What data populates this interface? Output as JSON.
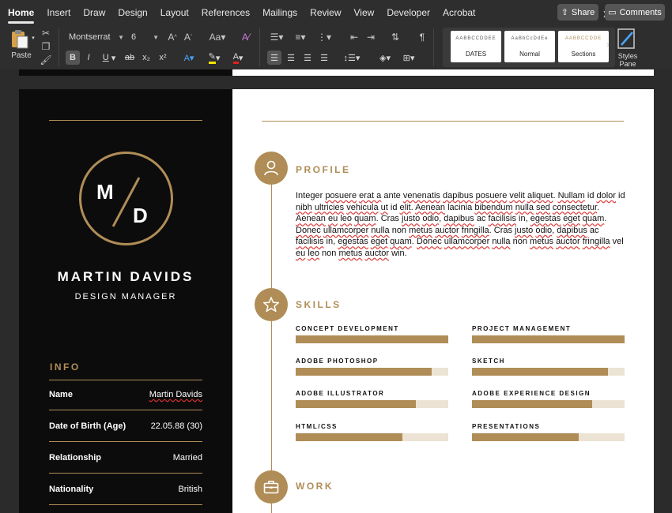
{
  "ribbon": {
    "tabs": [
      "Home",
      "Insert",
      "Draw",
      "Design",
      "Layout",
      "References",
      "Mailings",
      "Review",
      "View",
      "Developer",
      "Acrobat"
    ],
    "active_tab": "Home",
    "share_label": "Share",
    "comments_label": "Comments",
    "paste_label": "Paste",
    "font_name": "Montserrat",
    "font_size": "6",
    "styles": [
      {
        "sample": "AABBCCDDEE",
        "label": "DATES"
      },
      {
        "sample": "AaBbCcDdEe",
        "label": "Normal"
      },
      {
        "sample": "AABBCCDDE",
        "label": "Sections"
      }
    ],
    "styles_pane_label": "Styles Pane",
    "accent_color": "#b08d57"
  },
  "resume": {
    "monogram_first": "M",
    "monogram_second": "D",
    "name": "MARTIN DAVIDS",
    "role": "DESIGN MANAGER",
    "info_heading": "INFO",
    "info": [
      {
        "key": "Name",
        "value": "Martin Davids"
      },
      {
        "key": "Date of Birth (Age)",
        "value": "22.05.88 (30)"
      },
      {
        "key": "Relationship",
        "value": "Married"
      },
      {
        "key": "Nationality",
        "value": "British"
      }
    ],
    "sections": {
      "profile_title": "PROFILE",
      "skills_title": "SKILLS",
      "work_title": "WORK"
    },
    "profile_text": "Integer posuere erat a ante venenatis dapibus posuere velit aliquet. Nullam id dolor id nibh ultricies vehicula ut id elit. Aenean lacinia bibendum nulla sed consectetur. Aenean eu leo quam. Cras justo odio, dapibus ac facilisis in, egestas eget quam. Donec ullamcorper nulla non metus auctor fringilla. Cras justo odio, dapibus ac facilisis in, egestas eget quam. Donec ullamcorper nulla non metus auctor fringilla vel eu leo non metus auctor win.",
    "skills": [
      {
        "label": "CONCEPT DEVELOPMENT",
        "level": 1.0
      },
      {
        "label": "PROJECT MANAGEMENT",
        "level": 1.0
      },
      {
        "label": "ADOBE PHOTOSHOP",
        "level": 0.89
      },
      {
        "label": "SKETCH",
        "level": 0.89
      },
      {
        "label": "ADOBE ILLUSTRATOR",
        "level": 0.79
      },
      {
        "label": "ADOBE EXPERIENCE DESIGN",
        "level": 0.79
      },
      {
        "label": "HTML/CSS",
        "level": 0.7
      },
      {
        "label": "PRESENTATIONS",
        "level": 0.7
      }
    ]
  }
}
